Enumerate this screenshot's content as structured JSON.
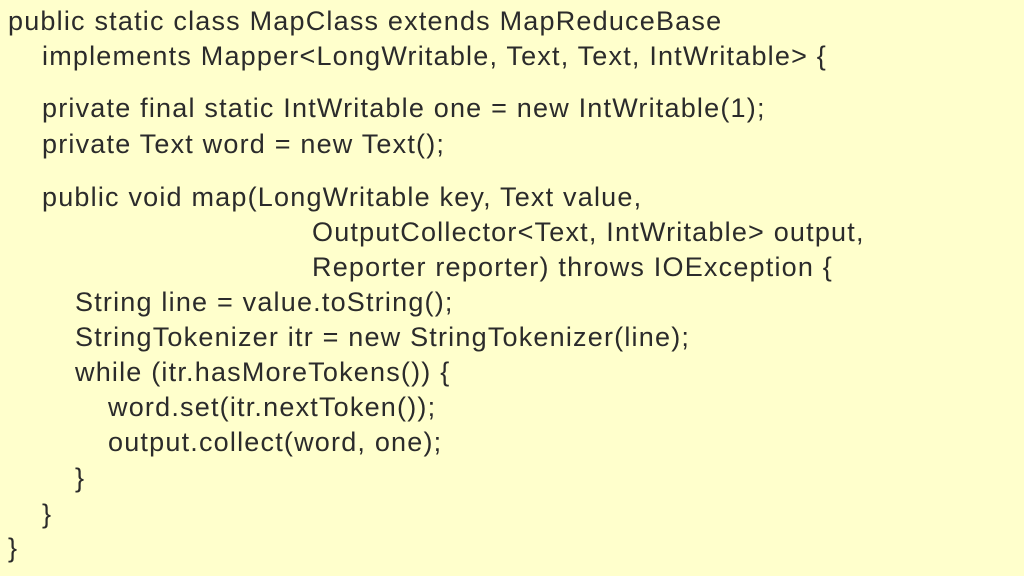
{
  "code": {
    "language": "java",
    "lines": [
      {
        "indent": 0,
        "text": "public static class MapClass extends MapReduceBase"
      },
      {
        "indent": 1,
        "text": "implements Mapper<LongWritable, Text, Text, IntWritable> {"
      },
      {
        "indent": 1,
        "text": "private final static IntWritable one = new IntWritable(1);"
      },
      {
        "indent": 1,
        "text": "private Text word = new Text();"
      },
      {
        "indent": 1,
        "text": "public void map(LongWritable key, Text value,"
      },
      {
        "indent": 9,
        "text": "OutputCollector<Text, IntWritable> output,"
      },
      {
        "indent": 9,
        "text": "Reporter reporter) throws IOException {"
      },
      {
        "indent": 2,
        "text": "String line = value.toString();"
      },
      {
        "indent": 2,
        "text": "StringTokenizer itr = new StringTokenizer(line);"
      },
      {
        "indent": 2,
        "text": "while (itr.hasMoreTokens()) {"
      },
      {
        "indent": 3,
        "text": "word.set(itr.nextToken());"
      },
      {
        "indent": 3,
        "text": "output.collect(word, one);"
      },
      {
        "indent": 2,
        "text": "}"
      },
      {
        "indent": 1,
        "text": "}"
      },
      {
        "indent": 0,
        "text": "}"
      }
    ]
  },
  "colors": {
    "background": "#FFFFCC",
    "text": "#2B2B2B"
  }
}
